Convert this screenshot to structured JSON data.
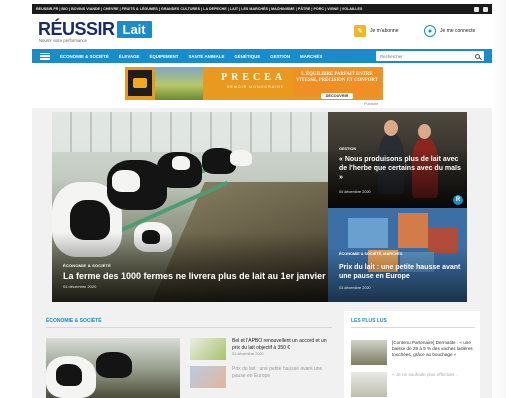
{
  "topbar": {
    "links": "REUSSIR.FR | BIO | BOVINS VIANDE | CHEVRE | FRUITS & LÉGUMES | GRANDES CULTURES | LA DEPECHE | LAIT | LES MARCHÉS | MACHINISME | PÂTRE | PORC | VIGNE | VOLAILLES"
  },
  "header": {
    "logo_word": "RÉUSSIR",
    "logo_box": "Lait",
    "tagline": "Nourrir votre performance",
    "subscribe_label": "Je m'abonne",
    "connect_label": "Je me connecte"
  },
  "nav": {
    "items": [
      "ÉCONOMIE & SOCIÉTÉ",
      "ÉLEVAGE",
      "ÉQUIPEMENT",
      "SANTÉ ANIMALE",
      "GÉNÉTIQUE",
      "GESTION",
      "MARCHÉS"
    ],
    "search_placeholder": "Rechercher"
  },
  "ad": {
    "brand": "PRECEA",
    "subtitle": "SEMOIR MONOGRAINE",
    "tagline": "L'ÉQUILIBRE PARFAIT ENTRE VITESSE, PRÉCISION ET CONFORT",
    "button": "DÉCOUVRIR",
    "caption": "Publicité"
  },
  "hero": {
    "category": "ÉCONOMIE & SOCIÉTÉ",
    "title": "La ferme des 1000 fermes ne livrera plus de lait au 1er janvier 2021",
    "date": "04 décembre 2020"
  },
  "side1": {
    "category": "GESTION",
    "title": "« Nous produisons plus de lait avec de l'herbe que certains avec du maïs »",
    "date": "04 décembre 2020",
    "badge": "R"
  },
  "side2": {
    "category": "ÉCONOMIE & SOCIÉTÉ, MARCHÉS",
    "title": "Prix du lait : une petite hausse avant une pause en Europe",
    "date": "03 décembre 2020"
  },
  "section": {
    "title": "ÉCONOMIE & SOCIÉTÉ",
    "items": [
      {
        "title": "Bel et l'APBO renouvellent un accord et un prix du lait objectif à 350 €",
        "date": "04 décembre 2020"
      },
      {
        "title": "Prix du lait : une petite hausse avant une pause en Europe",
        "date": ""
      }
    ]
  },
  "most_read": {
    "title": "LES PLUS LUS",
    "items": [
      {
        "title": "[Contenu Partenaire] Dermatite : « une baisse de 29 à 9 % des vaches laitières touchées, grâce au bouchage »"
      },
      {
        "title": "« Je ne souhaite plus effectuer..."
      }
    ]
  },
  "colors": {
    "brand_blue": "#1b8cc8",
    "logo_navy": "#1b2a6b",
    "ad_orange": "#e99a1e",
    "subscribe_yellow": "#f1b630"
  }
}
